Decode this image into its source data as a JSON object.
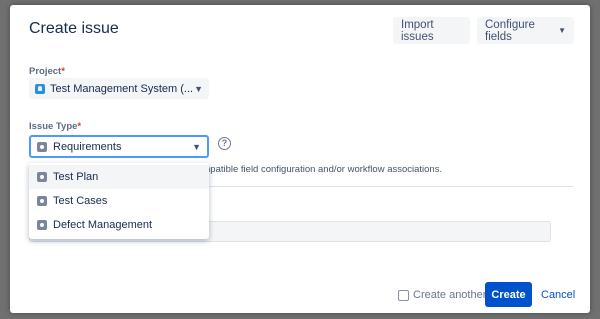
{
  "dialog": {
    "title": "Create issue",
    "import_label": "Import issues",
    "configure_label": "Configure fields"
  },
  "project": {
    "label": "Project",
    "required_mark": "*",
    "value": "Test Management System (..."
  },
  "issue_type": {
    "label": "Issue Type",
    "required_mark": "*",
    "value": "Requirements",
    "help_glyph": "?",
    "options": [
      {
        "label": "Test Plan"
      },
      {
        "label": "Test Cases"
      },
      {
        "label": "Defect Management"
      }
    ]
  },
  "note": "npatible field configuration and/or workflow associations.",
  "footer": {
    "create_another_label": "Create another",
    "create_label": "Create",
    "cancel_label": "Cancel"
  },
  "icons": {
    "project": "project-avatar-icon",
    "issue_type": "issue-type-icon",
    "help": "help-circle-icon",
    "chevron": "chevron-down-icon"
  },
  "colors": {
    "primary": "#0052cc",
    "focus": "#4c9aff",
    "required": "#de350b",
    "field_bg": "#f4f5f7"
  }
}
